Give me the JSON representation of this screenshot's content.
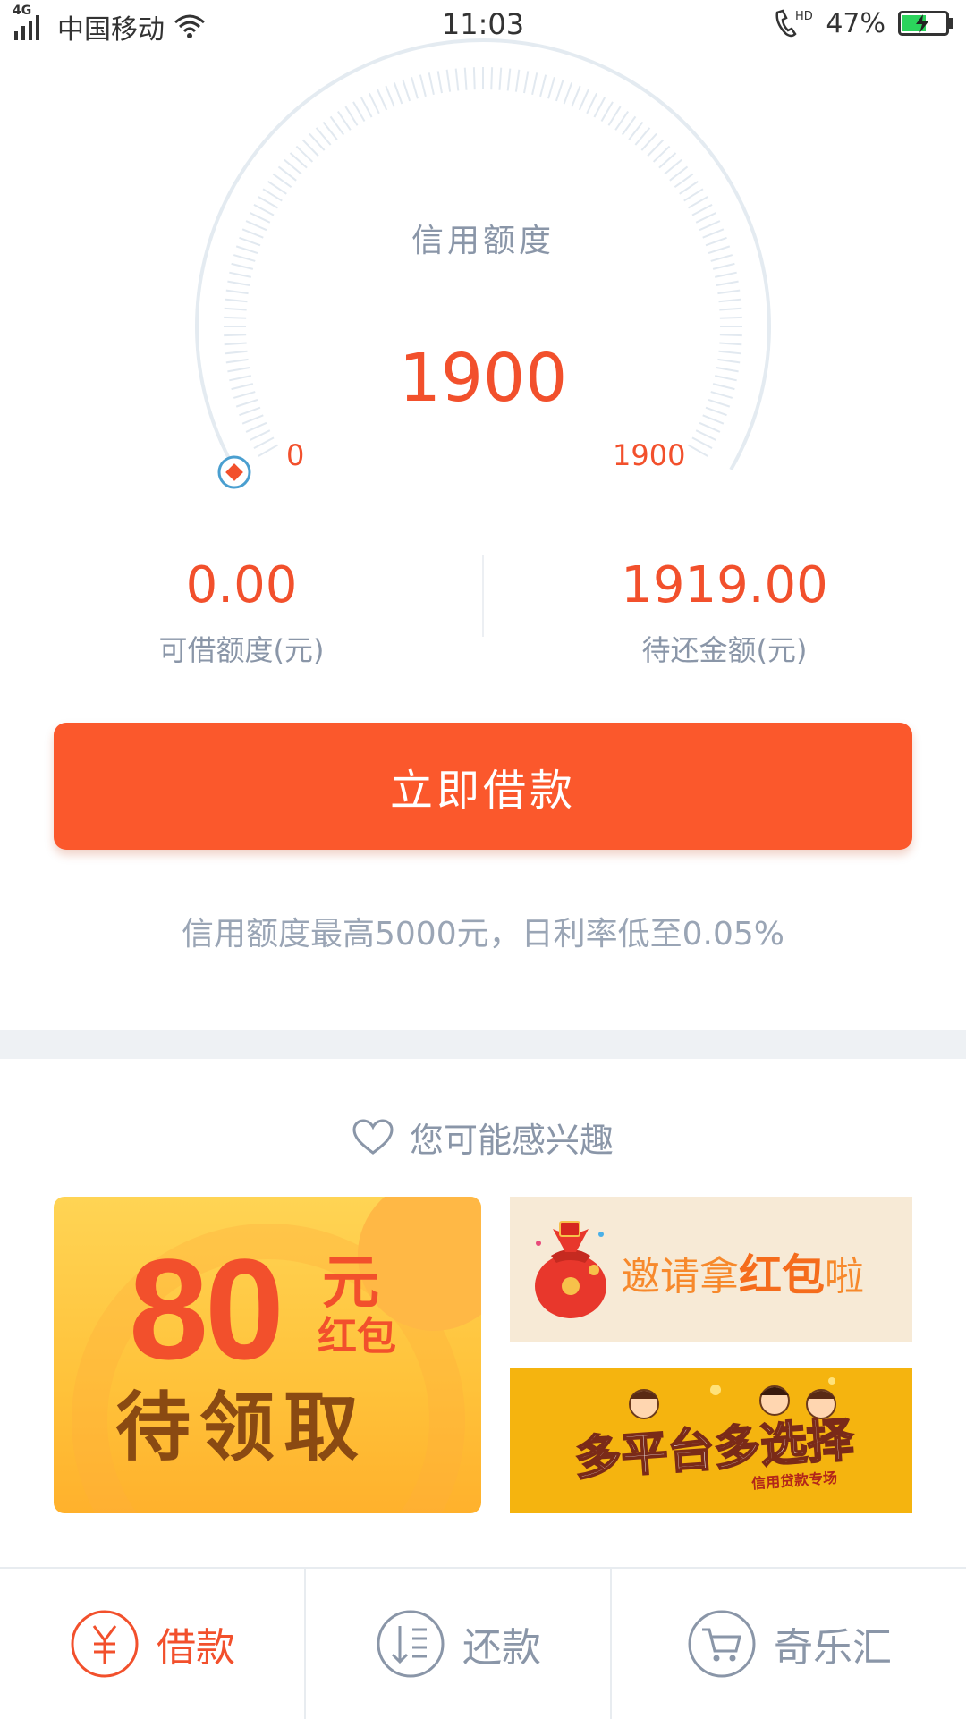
{
  "status_bar": {
    "network": "4G",
    "carrier": "中国移动",
    "time": "11:03",
    "call_label": "HD",
    "battery": "47%"
  },
  "gauge": {
    "title": "信用额度",
    "value": "1900",
    "min_label": "0",
    "max_label": "1900",
    "fill_fraction": 0.0
  },
  "stats": {
    "available": {
      "value": "0.00",
      "label": "可借额度(元)"
    },
    "due": {
      "value": "1919.00",
      "label": "待还金额(元)"
    }
  },
  "borrow_button": {
    "label": "立即借款"
  },
  "promo_text": "信用额度最高5000元，日利率低至0.05%",
  "interests": {
    "title": "您可能感兴趣",
    "banner_80": {
      "amount": "80",
      "unit": "元",
      "sub": "红包",
      "claim": "待领取"
    },
    "banner_invite": {
      "text_prefix": "邀请拿",
      "text_highlight": "红包",
      "text_suffix": "啦"
    },
    "banner_multi": {
      "text": "多平台多选择",
      "sub": "信用贷款专场"
    }
  },
  "bottom_nav": [
    {
      "label": "借款",
      "icon": "yen-circle-icon",
      "active": true
    },
    {
      "label": "还款",
      "icon": "repay-list-icon",
      "active": false
    },
    {
      "label": "奇乐汇",
      "icon": "cart-icon",
      "active": false
    }
  ],
  "colors": {
    "accent": "#f2502c",
    "button": "#fb582c",
    "muted_text": "#8a96a8",
    "banner_yellow": "#ffc23a",
    "banner_cream": "#f7ead6"
  }
}
